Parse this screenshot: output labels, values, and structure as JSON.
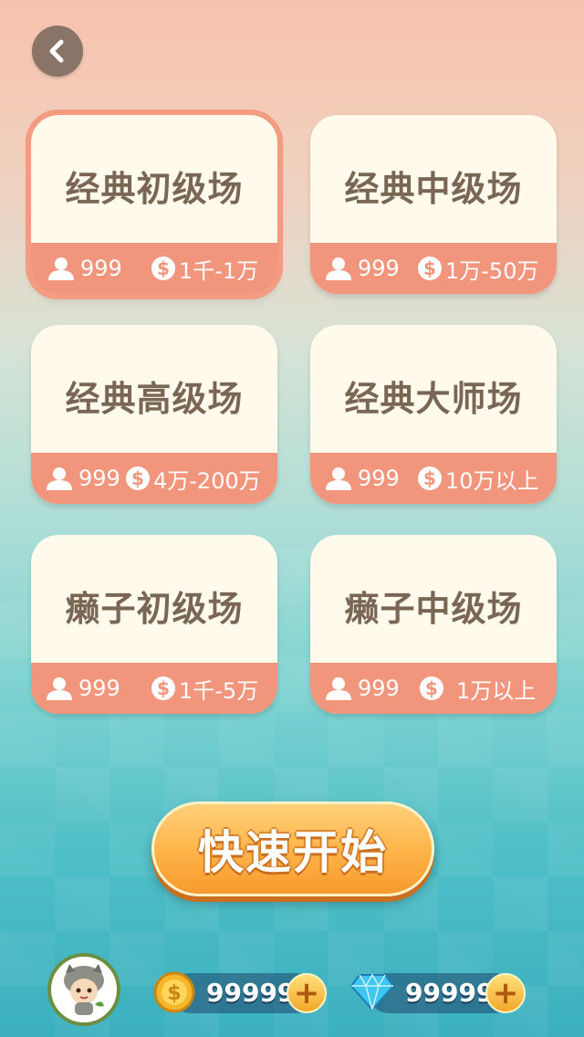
{
  "rooms": [
    {
      "title": "经典初级场",
      "players": "999",
      "range": "1千-1万",
      "selected": true
    },
    {
      "title": "经典中级场",
      "players": "999",
      "range": "1万-50万",
      "selected": false
    },
    {
      "title": "经典高级场",
      "players": "999",
      "range": "4万-200万",
      "selected": false
    },
    {
      "title": "经典大师场",
      "players": "999",
      "range": "10万以上",
      "selected": false
    },
    {
      "title": "癞子初级场",
      "players": "999",
      "range": "1千-5万",
      "selected": false
    },
    {
      "title": "癞子中级场",
      "players": "999",
      "range": "1万以上",
      "selected": false
    }
  ],
  "quick_start": "快速开始",
  "resources": {
    "coins": "99999",
    "diamonds": "99999"
  },
  "colors": {
    "card_bar": "#f2957d",
    "card_title": "#7a6655",
    "quick_button": "#ffb347"
  },
  "icons": {
    "back": "chevron-left-icon",
    "players": "person-icon",
    "coin": "dollar-coin-icon",
    "diamond": "diamond-icon",
    "plus": "plus-icon"
  }
}
